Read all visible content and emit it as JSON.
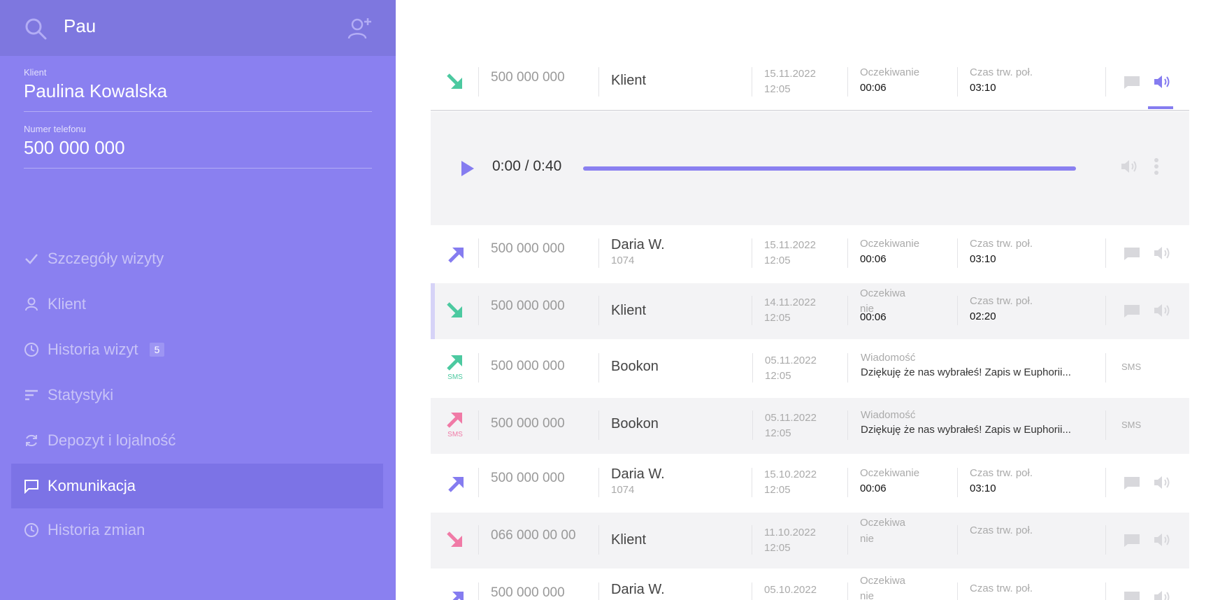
{
  "sidebar": {
    "search_value": "Pau",
    "client_label": "Klient",
    "client_name": "Paulina Kowalska",
    "phone_label": "Numer telefonu",
    "phone_value": "500 000 000",
    "nav": [
      {
        "label": "Szczegóły wizyty",
        "icon": "check-icon"
      },
      {
        "label": "Klient",
        "icon": "person-icon"
      },
      {
        "label": "Historia wizyt",
        "icon": "clock-icon",
        "badge": "5"
      },
      {
        "label": "Statystyki",
        "icon": "sort-icon"
      },
      {
        "label": "Depozyt i lojalność",
        "icon": "refresh-icon"
      },
      {
        "label": "Komunikacja",
        "icon": "chat-icon",
        "active": true
      },
      {
        "label": "Historia zmian",
        "icon": "clock-icon"
      }
    ]
  },
  "player": {
    "time": "0:00 / 0:40"
  },
  "rows": [
    {
      "phone": "500 000 000",
      "name": "Klient",
      "sub": "",
      "date": "15.11.2022",
      "time": "12:05",
      "lbl1": "Oczekiwanie",
      "val1": "00:06",
      "lbl2": "Czas trw. poł.",
      "val2": "03:10",
      "arrow": "in-green"
    },
    {
      "phone": "500 000 000",
      "name": "Daria W.",
      "sub": "1074",
      "date": "15.11.2022",
      "time": "12:05",
      "lbl1": "Oczekiwanie",
      "val1": "00:06",
      "lbl2": "Czas trw. poł.",
      "val2": "03:10",
      "arrow": "out-purple"
    },
    {
      "phone": "500 000 000",
      "name": "Klient",
      "sub": "",
      "date": "14.11.2022",
      "time": "12:05",
      "lbl1": "Oczekiwa",
      "lbl1b": "nie",
      "val1": "00:06",
      "lbl2": "Czas trw. poł.",
      "val2": "02:20",
      "arrow": "in-green"
    },
    {
      "phone": "500 000 000",
      "name": "Bookon",
      "sub": "",
      "date": "05.11.2022",
      "time": "12:05",
      "msg_label": "Wiadomość",
      "msg": "Dziękuję że nas wybrałeś! Zapis w Euphorii...",
      "sms": "SMS",
      "arrow": "sms-green"
    },
    {
      "phone": "500 000 000",
      "name": "Bookon",
      "sub": "",
      "date": "05.11.2022",
      "time": "12:05",
      "msg_label": "Wiadomość",
      "msg": "Dziękuję że nas wybrałeś! Zapis w Euphorii...",
      "sms": "SMS",
      "arrow": "sms-pink"
    },
    {
      "phone": "500 000 000",
      "name": "Daria W.",
      "sub": "1074",
      "date": "15.10.2022",
      "time": "12:05",
      "lbl1": "Oczekiwanie",
      "val1": "00:06",
      "lbl2": "Czas trw. poł.",
      "val2": "03:10",
      "arrow": "out-purple"
    },
    {
      "phone": "066 000 00 00",
      "name": "Klient",
      "sub": "",
      "date": "11.10.2022",
      "time": "12:05",
      "lbl1": "Oczekiwa",
      "lbl1b": "nie",
      "val1": "",
      "lbl2": "Czas trw. poł.",
      "val2": "",
      "arrow": "in-pink"
    },
    {
      "phone": "500 000 000",
      "name": "Daria W.",
      "sub": "",
      "date": "05.10.2022",
      "time": "",
      "lbl1": "Oczekiwa",
      "lbl1b": "nie",
      "val1": "",
      "lbl2": "Czas trw. poł.",
      "val2": "",
      "arrow": "out-purple"
    }
  ],
  "sms_arrow_text": "SMS",
  "colors": {
    "accent": "#8a80f0",
    "green": "#4cc9a0",
    "pink": "#f07aa6",
    "purple": "#857cf0"
  }
}
